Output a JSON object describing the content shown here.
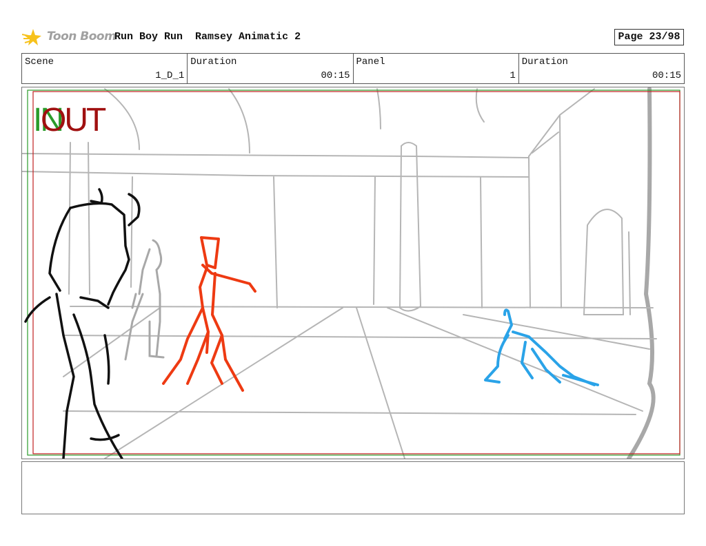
{
  "header": {
    "logo_text": "Toon Boom",
    "project": "Run Boy Run",
    "episode": "Ramsey Animatic 2",
    "page": "Page 23/98"
  },
  "meta": {
    "scene_label": "Scene",
    "scene_value": "1_D_1",
    "scene_duration_label": "Duration",
    "scene_duration_value": "00:15",
    "panel_label": "Panel",
    "panel_value": "1",
    "panel_duration_label": "Duration",
    "panel_duration_value": "00:15"
  },
  "panel": {
    "in_mark": "IN",
    "out_mark": "OUT"
  },
  "colors": {
    "in_frame": "#2a9b2a",
    "out_frame": "#c02020",
    "sketch_grey": "#b0b0b0",
    "sketch_red": "#ee3a12",
    "sketch_blue": "#2aa3e8"
  },
  "caption": ""
}
